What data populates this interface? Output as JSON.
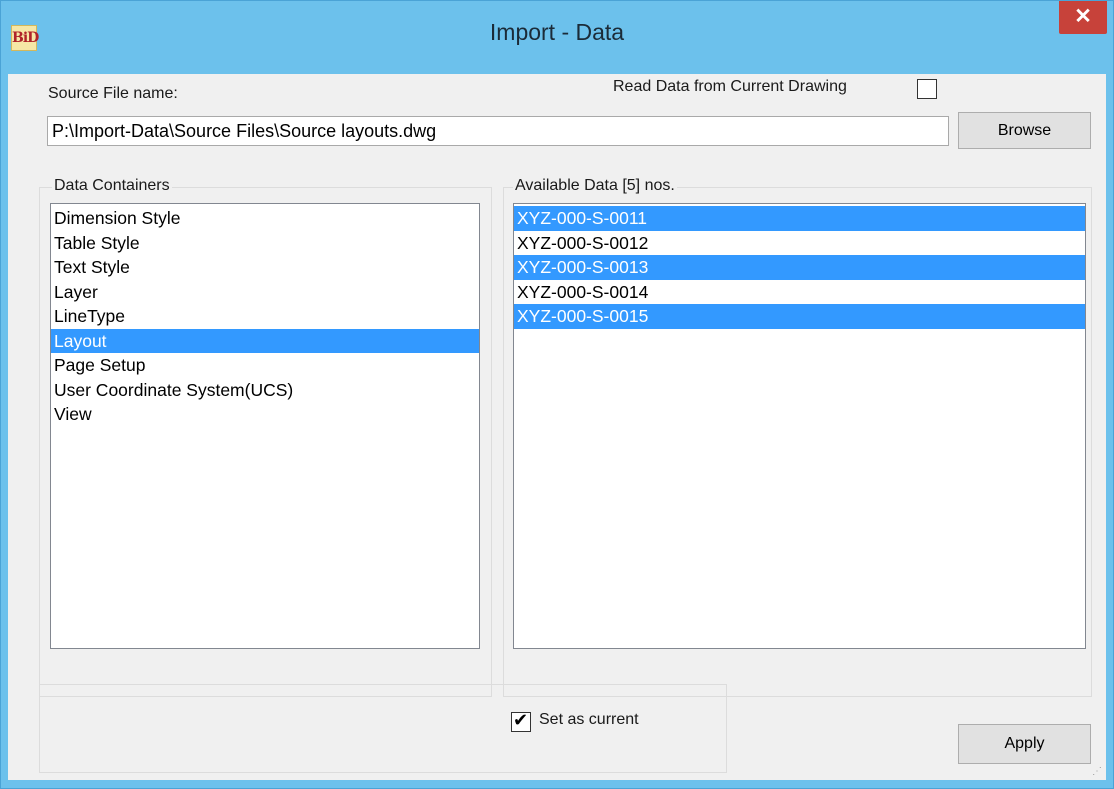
{
  "window": {
    "title": "Import - Data",
    "app_icon_text": "BiD",
    "close_glyph": "✕"
  },
  "source": {
    "label": "Source File name:",
    "path": "P:\\Import-Data\\Source Files\\Source layouts.dwg",
    "browse_label": "Browse",
    "read_current_label": "Read Data from Current Drawing",
    "read_current_checked": false
  },
  "containers": {
    "label": "Data Containers",
    "items": [
      {
        "label": "Dimension Style",
        "selected": false
      },
      {
        "label": "Table Style",
        "selected": false
      },
      {
        "label": "Text Style",
        "selected": false
      },
      {
        "label": "Layer",
        "selected": false
      },
      {
        "label": "LineType",
        "selected": false
      },
      {
        "label": "Layout",
        "selected": true
      },
      {
        "label": "Page Setup",
        "selected": false
      },
      {
        "label": "User Coordinate System(UCS)",
        "selected": false
      },
      {
        "label": "View",
        "selected": false
      }
    ]
  },
  "available": {
    "label": "Available Data [5] nos.",
    "items": [
      {
        "label": "XYZ-000-S-0011",
        "selected": true
      },
      {
        "label": "XYZ-000-S-0012",
        "selected": false
      },
      {
        "label": "XYZ-000-S-0013",
        "selected": true
      },
      {
        "label": "XYZ-000-S-0014",
        "selected": false
      },
      {
        "label": "XYZ-000-S-0015",
        "selected": true
      }
    ]
  },
  "options": {
    "set_current_label": "Set as current",
    "set_current_checked": true
  },
  "apply_label": "Apply",
  "colors": {
    "title_bar": "#6cc1ec",
    "close_button": "#c7423a",
    "selection": "#3399ff"
  }
}
